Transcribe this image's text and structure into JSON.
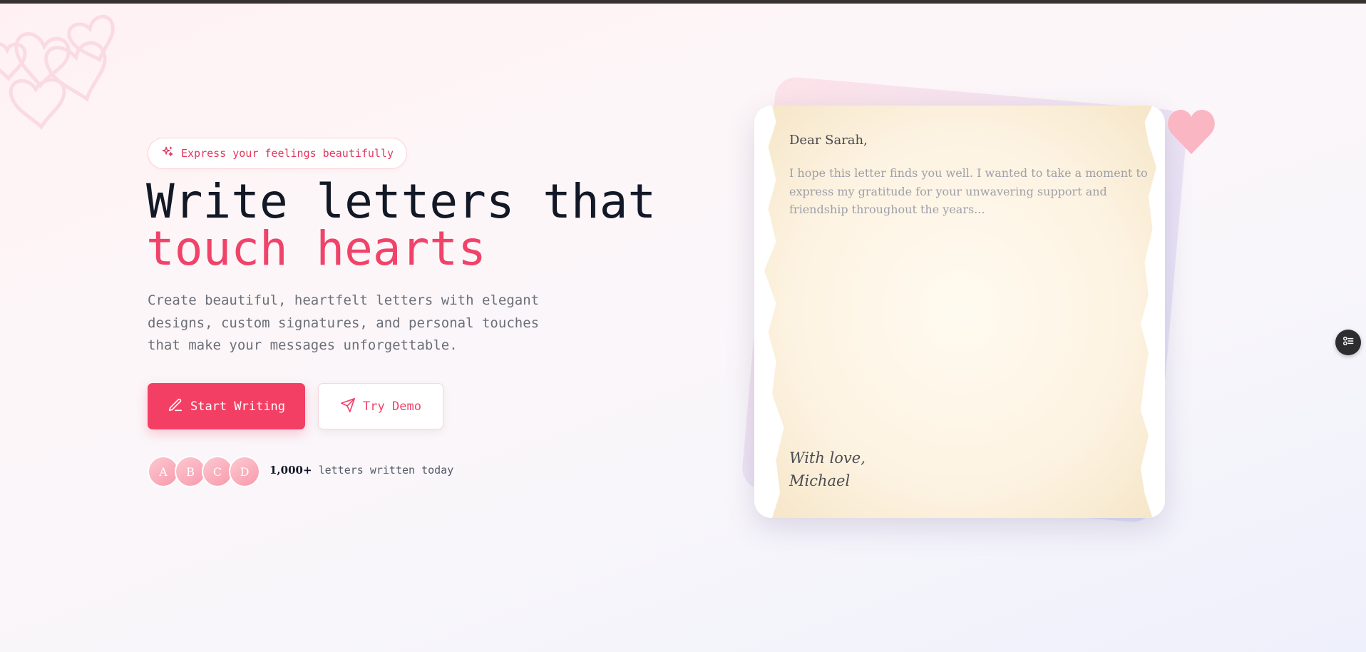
{
  "hero": {
    "badge": {
      "icon": "sparkles-icon",
      "text": "Express your feelings beautifully"
    },
    "title_line1": "Write letters that",
    "title_line2": "touch hearts",
    "description": "Create beautiful, heartfelt letters with elegant designs, custom signatures, and personal touches that make your messages unforgettable.",
    "primary_button": {
      "icon": "pen-icon",
      "label": "Start Writing"
    },
    "secondary_button": {
      "icon": "send-icon",
      "label": "Try Demo"
    },
    "avatars": [
      "A",
      "B",
      "C",
      "D"
    ],
    "stat": {
      "count": "1,000+",
      "text": "letters written today"
    }
  },
  "letter": {
    "greeting": "Dear Sarah,",
    "body": "I hope this letter finds you well. I wanted to take a moment to express my gratitude for your unwavering support and friendship throughout the years...",
    "closing_line1": "With love,",
    "closing_line2": "Michael"
  },
  "decor": {
    "heart_icon": "heart-icon",
    "side_button_icon": "toggle-list-icon"
  },
  "colors": {
    "accent": "#f43f64",
    "accent_text": "#f0436a",
    "heading": "#121826",
    "muted": "#6c6f78",
    "topbar": "#37322f"
  }
}
